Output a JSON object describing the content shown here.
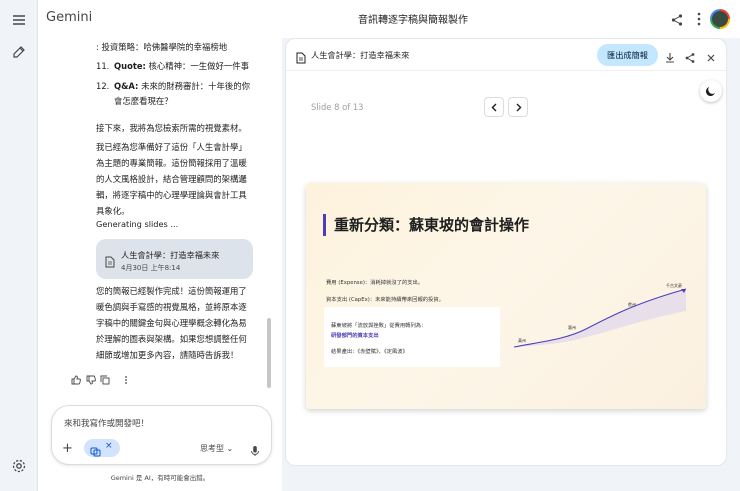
{
  "app": {
    "brand": "Gemini",
    "doc_title": "音訊轉逐字稿與簡報製作"
  },
  "chat": {
    "list_items": [
      {
        "num": "",
        "text": ": 投資策略：哈佛醫學院的幸福榜地"
      },
      {
        "num": "11.",
        "label": "Quote:",
        "text": " 核心精神：一生做好一件事"
      },
      {
        "num": "12.",
        "label": "Q&A:",
        "text": " 未來的財務審計：十年後的你"
      },
      {
        "num": "",
        "text": "會怎麼看現在？"
      }
    ],
    "intro": "接下來，我將為您檢索所需的視覺素材。",
    "paragraph1_lines": [
      "我已經為您準備好了這份「人生會計學」",
      "為主題的專業簡報。這份簡報採用了溫暖",
      "的人文風格設計，結合管理顧問的架構邏",
      "輯，將逐字稿中的心理學理論與會計工具",
      "具象化。"
    ],
    "generating": "Generating slides ...",
    "card": {
      "title": "人生會計學：打造幸福未來",
      "date": "4月30日 上午8:14"
    },
    "paragraph2_lines": [
      "您的簡報已經製作完成！這份簡報運用了",
      "暖色調與手寫感的視覺風格，並將原本逐",
      "字稿中的關鍵金句與心理學概念轉化為易",
      "於理解的圖表與架構。如果您想調整任何",
      "細節或增加更多內容，請隨時告訴我！"
    ]
  },
  "composer": {
    "placeholder": "來和我寫作或開發吧！",
    "mode_label": "思考型"
  },
  "footer": "Gemini 是 AI，有時可能會出錯。",
  "panel": {
    "title": "人生會計學：打造幸福未來",
    "export_label": "匯出成簡報",
    "slide_counter": "Slide 8 of 13"
  },
  "slide": {
    "title": "重新分類：蘇東坡的會計操作",
    "expense_line": "費用 (Expense)：消耗掉就沒了的支出。",
    "capex_line": "資本支出 (CapEx)：未來能持續帶來回報的投資。",
    "box_line1": "蘇東坡將「流放與挫敗」從費用轉列為：",
    "box_line2": "研發部門的資本支出",
    "box_line3": "結果產出：《赤壁賦》、《定風波》",
    "curve_labels": [
      "黃州",
      "惠州",
      "儋州",
      "千古文豪"
    ]
  },
  "colors": {
    "accent": "#4a3fb8",
    "export_bg": "#c2e7ff",
    "chip_bg": "#d3e3fd",
    "card_bg": "#dde3ea"
  }
}
